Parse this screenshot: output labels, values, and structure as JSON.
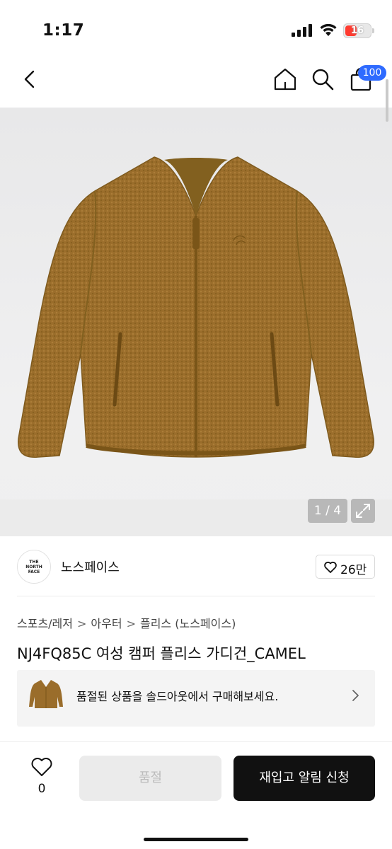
{
  "status_bar": {
    "time": "1:17",
    "battery": "16"
  },
  "nav": {
    "cart_count": "100"
  },
  "gallery": {
    "page_indicator": "1 / 4"
  },
  "brand": {
    "name": "노스페이스",
    "likes": "26만",
    "logo_lines": [
      "THE",
      "NORTH",
      "FACE"
    ]
  },
  "breadcrumb": [
    "스포츠/레저",
    "아우터",
    "플리스 (노스페이스)"
  ],
  "product": {
    "title": "NJ4FQ85C 여성 캠퍼 플리스 가디건_CAMEL",
    "color": "#9a6d2b"
  },
  "soldout_banner": {
    "text": "품절된 상품을 솔드아웃에서 구매해보세요."
  },
  "bottom_bar": {
    "wish_count": "0",
    "soldout_label": "품절",
    "restock_label": "재입고 알림 신청"
  },
  "colors": {
    "accent": "#2f6bff",
    "primary_button": "#111111",
    "disabled_button": "#ebebeb"
  }
}
